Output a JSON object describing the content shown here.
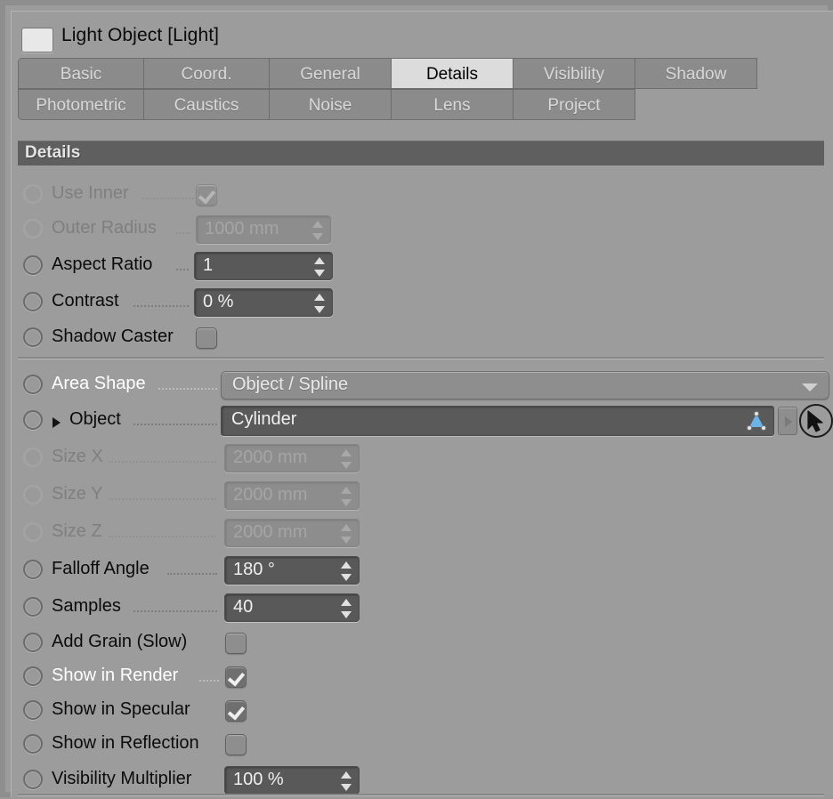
{
  "window": {
    "object_title": "Light Object [Light]",
    "swatch_color": "#e8e8e8"
  },
  "tabs": {
    "row1": [
      {
        "label": "Basic",
        "active": false
      },
      {
        "label": "Coord.",
        "active": false
      },
      {
        "label": "General",
        "active": false
      },
      {
        "label": "Details",
        "active": true
      },
      {
        "label": "Visibility",
        "active": false
      },
      {
        "label": "Shadow",
        "active": false
      }
    ],
    "row2": [
      {
        "label": "Photometric",
        "active": false
      },
      {
        "label": "Caustics",
        "active": false
      },
      {
        "label": "Noise",
        "active": false
      },
      {
        "label": "Lens",
        "active": false
      },
      {
        "label": "Project",
        "active": false
      }
    ]
  },
  "group": {
    "header": "Details"
  },
  "properties": {
    "use_inner": {
      "label": "Use Inner",
      "type": "checkbox",
      "checked": true,
      "enabled": false
    },
    "outer_radius": {
      "label": "Outer Radius",
      "type": "number",
      "value": "1000 mm",
      "enabled": false
    },
    "aspect_ratio": {
      "label": "Aspect Ratio",
      "type": "number",
      "value": "1",
      "enabled": true
    },
    "contrast": {
      "label": "Contrast",
      "type": "number",
      "value": "0 %",
      "enabled": true
    },
    "shadow_caster": {
      "label": "Shadow Caster",
      "type": "checkbox",
      "checked": false,
      "enabled": true
    },
    "area_shape": {
      "label": "Area Shape",
      "type": "dropdown",
      "value": "Object / Spline",
      "enabled": true,
      "highlighted": true
    },
    "object": {
      "label": "Object",
      "type": "link",
      "value": "Cylinder",
      "enabled": true,
      "icon": "polygon-object-icon"
    },
    "size_x": {
      "label": "Size X",
      "type": "number",
      "value": "2000 mm",
      "enabled": false
    },
    "size_y": {
      "label": "Size Y",
      "type": "number",
      "value": "2000 mm",
      "enabled": false
    },
    "size_z": {
      "label": "Size Z",
      "type": "number",
      "value": "2000 mm",
      "enabled": false
    },
    "falloff_angle": {
      "label": "Falloff Angle",
      "type": "number",
      "value": "180 °",
      "enabled": true
    },
    "samples": {
      "label": "Samples",
      "type": "number",
      "value": "40",
      "enabled": true
    },
    "add_grain": {
      "label": "Add Grain (Slow)",
      "type": "checkbox",
      "checked": false,
      "enabled": true
    },
    "show_in_render": {
      "label": "Show in Render",
      "type": "checkbox",
      "checked": true,
      "enabled": true,
      "highlighted": true
    },
    "show_in_specular": {
      "label": "Show in Specular",
      "type": "checkbox",
      "checked": true,
      "enabled": true
    },
    "show_in_reflection": {
      "label": "Show in Reflection",
      "type": "checkbox",
      "checked": false,
      "enabled": true
    },
    "visibility_multiplier": {
      "label": "Visibility Multiplier",
      "type": "number",
      "value": "100 %",
      "enabled": true
    }
  },
  "buttons": {
    "object_expand": "expand-object-arrow",
    "object_pick": "pick-cursor-button"
  },
  "colors": {
    "panel_bg": "#9c9c9c",
    "header_bg": "#5f5f5f",
    "field_bg": "#595959",
    "tab_active_bg": "#dcdcdc",
    "accent_icon": "#6cb4e8"
  }
}
